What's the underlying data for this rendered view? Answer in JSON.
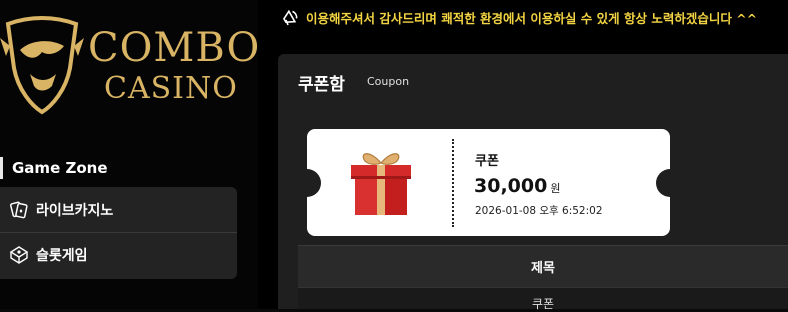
{
  "brand": {
    "line1": "COMBO",
    "line2": "CASINO",
    "color": "#d8b464"
  },
  "sidebar": {
    "section_title": "Game Zone",
    "items": [
      {
        "label": "라이브카지노",
        "icon": "cards-icon"
      },
      {
        "label": "슬롯게임",
        "icon": "slot-machine-icon"
      }
    ]
  },
  "notice": {
    "icon": "megaphone-icon",
    "text": "이용해주셔서 감사드리며 쾌적한 환경에서 이용하실 수 있게 항상 노력하겠습니다 ^^",
    "color": "#f3d443"
  },
  "coupon_box": {
    "title": "쿠폰함",
    "subtitle": "Coupon",
    "coupon": {
      "icon": "gift-box-icon",
      "label": "쿠폰",
      "amount": "30,000",
      "unit": "원",
      "date": "2026-01-08 오후 6:52:02"
    },
    "table": {
      "headers": [
        "제목"
      ],
      "rows": [
        [
          "쿠폰"
        ]
      ]
    }
  }
}
